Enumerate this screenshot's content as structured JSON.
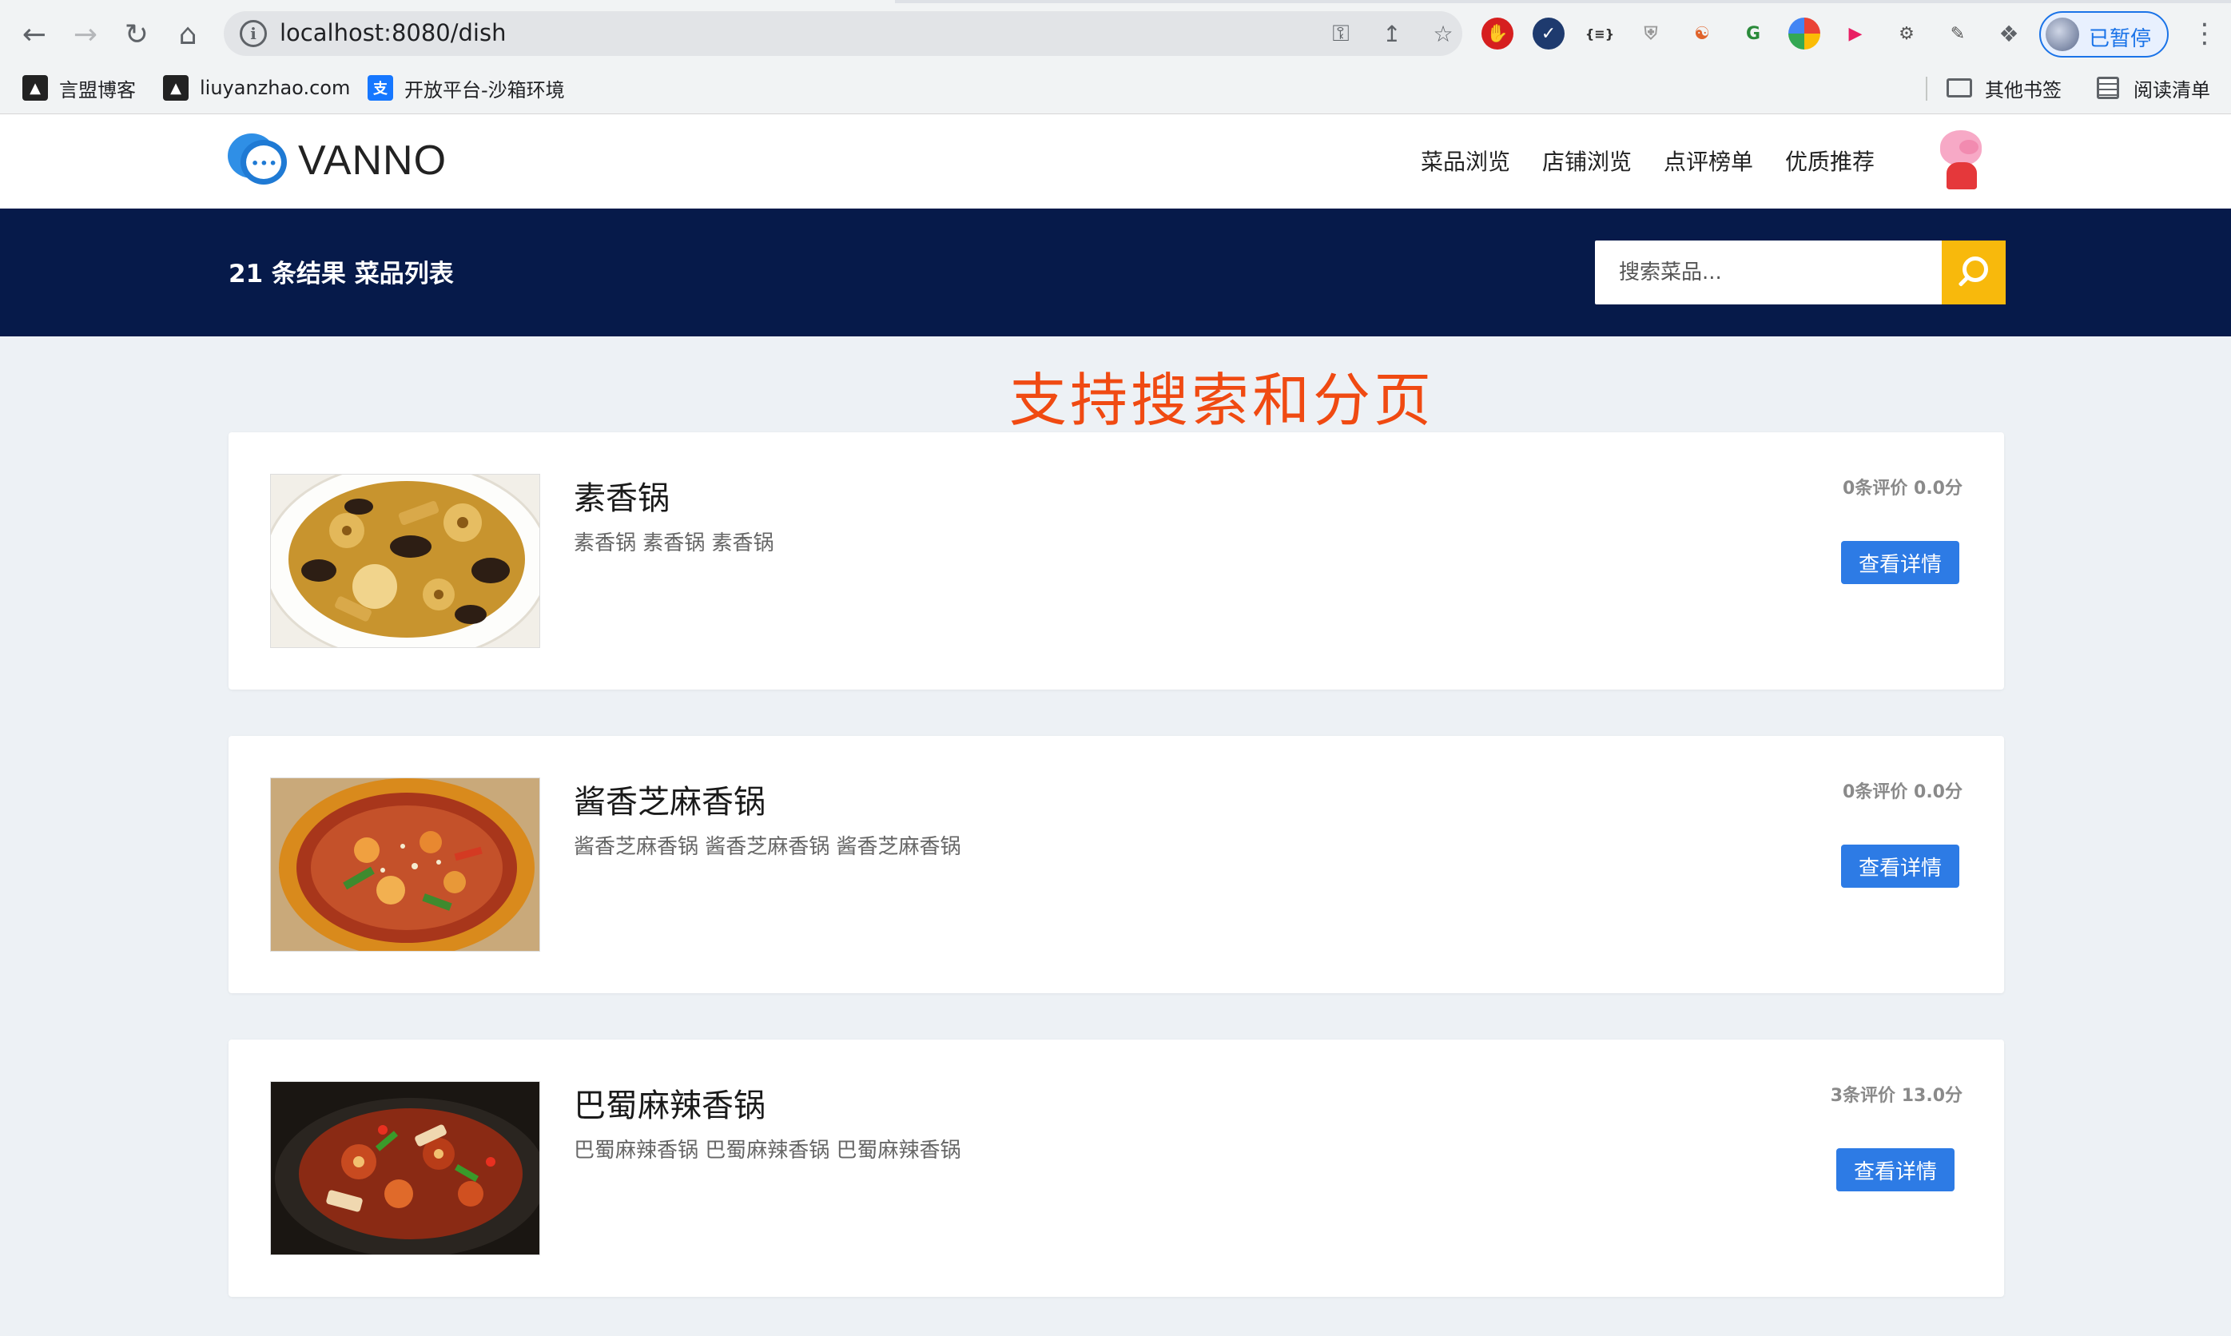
{
  "browser": {
    "url": "localhost:8080/dish",
    "profile_label": "已暂停",
    "bookmarks": [
      {
        "label": "言盟博客",
        "icon": "lighthouse-icon"
      },
      {
        "label": "liuyanzhao.com",
        "icon": "lighthouse-icon"
      },
      {
        "label": "开放平台-沙箱环境",
        "icon": "alipay-icon"
      }
    ],
    "other_bookmarks": "其他书签",
    "reading_list": "阅读清单"
  },
  "site": {
    "logo_text": "VANNO",
    "nav": [
      "菜品浏览",
      "店铺浏览",
      "点评榜单",
      "优质推荐"
    ]
  },
  "banner": {
    "result_count": "21",
    "result_title": "21 条结果 菜品列表",
    "search_placeholder": "搜索菜品..."
  },
  "annotation": "支持搜索和分页",
  "dishes": [
    {
      "name": "素香锅",
      "description": "素香锅 素香锅 素香锅",
      "stats": "0条评价  0.0分",
      "button": "查看详情"
    },
    {
      "name": "酱香芝麻香锅",
      "description": "酱香芝麻香锅 酱香芝麻香锅 酱香芝麻香锅",
      "stats": "0条评价  0.0分",
      "button": "查看详情"
    },
    {
      "name": "巴蜀麻辣香锅",
      "description": "巴蜀麻辣香锅 巴蜀麻辣香锅 巴蜀麻辣香锅",
      "stats": "3条评价  13.0分",
      "button": "查看详情"
    }
  ],
  "colors": {
    "banner_bg": "#061a4a",
    "search_button": "#f8b90c",
    "detail_button": "#2d7be5",
    "annotation": "#f04a12"
  }
}
